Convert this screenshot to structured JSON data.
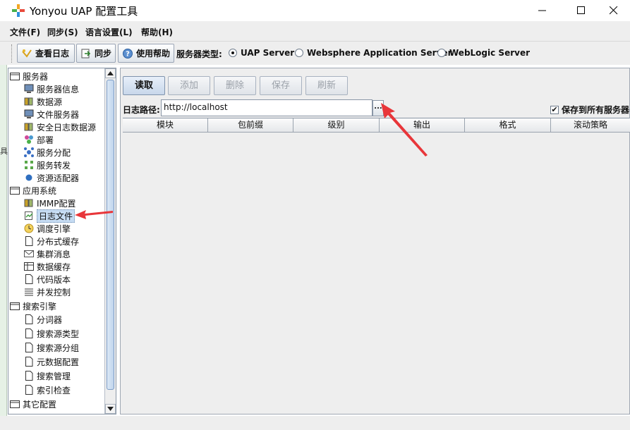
{
  "window": {
    "title": "Yonyou UAP 配置工具"
  },
  "menu": [
    {
      "label": "文件(F)"
    },
    {
      "label": "同步(S)"
    },
    {
      "label": "语言设置(L)"
    },
    {
      "label": "帮助(H)"
    }
  ],
  "toolbar": {
    "view_log": "查看日志",
    "sync": "同步",
    "help": "使用帮助",
    "server_type_label": "服务器类型:",
    "server_types": [
      {
        "label": "UAP Server",
        "selected": true
      },
      {
        "label": "Websphere Application Server",
        "selected": false
      },
      {
        "label": "WebLogic Server",
        "selected": false
      }
    ]
  },
  "left_edge_text": "具",
  "tree": {
    "groups": [
      {
        "label": "服务器",
        "items": [
          "服务器信息",
          "数据源",
          "文件服务器",
          "安全日志数据源",
          "部署",
          "服务分配",
          "服务转发",
          "资源适配器"
        ]
      },
      {
        "label": "应用系统",
        "items": [
          "IMMP配置",
          "日志文件",
          "调度引擎",
          "分布式缓存",
          "集群消息",
          "数据缓存",
          "代码版本",
          "并发控制"
        ]
      },
      {
        "label": "搜索引擎",
        "items": [
          "分词器",
          "搜索源类型",
          "搜索源分组",
          "元数据配置",
          "搜索管理",
          "索引检查"
        ]
      },
      {
        "label": "其它配置",
        "items": []
      }
    ],
    "selected": "日志文件"
  },
  "content": {
    "buttons": [
      {
        "label": "读取",
        "enabled": true
      },
      {
        "label": "添加",
        "enabled": false
      },
      {
        "label": "删除",
        "enabled": false
      },
      {
        "label": "保存",
        "enabled": false
      },
      {
        "label": "刷新",
        "enabled": false
      }
    ],
    "path_label": "日志路径:",
    "path_value": "http://localhost",
    "browse_label": "...",
    "save_all_label": "保存到所有服务器",
    "save_all_checked": true,
    "columns": [
      "模块",
      "包前缀",
      "级别",
      "输出",
      "格式",
      "滚动策略"
    ]
  },
  "colors": {
    "annotation_arrow": "#e8363a",
    "selection": "#c6dcf3"
  }
}
